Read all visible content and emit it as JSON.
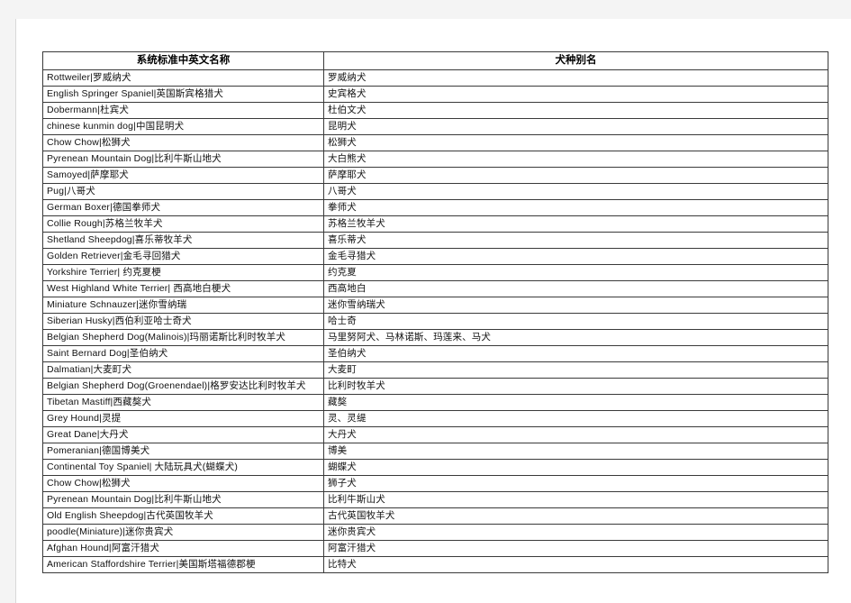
{
  "document": {
    "table": {
      "headers": [
        "系统标准中英文名称",
        "犬种别名"
      ],
      "rows": [
        {
          "name": "Rottweiler|罗威纳犬",
          "alias": "罗威纳犬"
        },
        {
          "name": "English Springer Spaniel|英国斯宾格猎犬",
          "alias": "史宾格犬"
        },
        {
          "name": "Dobermann|杜宾犬",
          "alias": "杜伯文犬"
        },
        {
          "name": "chinese kunmin dog|中国昆明犬",
          "alias": "昆明犬"
        },
        {
          "name": "Chow Chow|松狮犬",
          "alias": "松狮犬"
        },
        {
          "name": "Pyrenean Mountain Dog|比利牛斯山地犬",
          "alias": "大白熊犬"
        },
        {
          "name": "Samoyed|萨摩耶犬",
          "alias": "萨摩耶犬"
        },
        {
          "name": "Pug|八哥犬",
          "alias": "八哥犬"
        },
        {
          "name": "German Boxer|德国拳师犬",
          "alias": "拳师犬"
        },
        {
          "name": "Collie Rough|苏格兰牧羊犬",
          "alias": "苏格兰牧羊犬"
        },
        {
          "name": "Shetland Sheepdog|喜乐蒂牧羊犬",
          "alias": "喜乐蒂犬"
        },
        {
          "name": "Golden Retriever|金毛寻回猎犬",
          "alias": "金毛寻猎犬"
        },
        {
          "name": "Yorkshire Terrier| 约克夏梗",
          "alias": "约克夏"
        },
        {
          "name": "West Highland White Terrier| 西高地白梗犬",
          "alias": "西高地白"
        },
        {
          "name": "Miniature Schnauzer|迷你雪纳瑞",
          "alias": "迷你雪纳瑞犬"
        },
        {
          "name": "Siberian Husky|西伯利亚哈士奇犬",
          "alias": "哈士奇"
        },
        {
          "name": "Belgian Shepherd Dog(Malinois)|玛丽诺斯比利时牧羊犬",
          "alias": "马里努阿犬、马林诺斯、玛莲来、马犬"
        },
        {
          "name": "Saint Bernard Dog|圣伯纳犬",
          "alias": "圣伯纳犬"
        },
        {
          "name": "Dalmatian|大麦町犬",
          "alias": "大麦町"
        },
        {
          "name": "Belgian Shepherd Dog(Groenendael)|格罗安达比利时牧羊犬",
          "alias": "比利时牧羊犬"
        },
        {
          "name": "Tibetan Mastiff|西藏獒犬",
          "alias": "藏獒"
        },
        {
          "name": "Grey Hound|灵提",
          "alias": "灵、灵缇"
        },
        {
          "name": "Great Dane|大丹犬",
          "alias": "大丹犬"
        },
        {
          "name": "Pomeranian|德国博美犬",
          "alias": "博美"
        },
        {
          "name": "Continental Toy Spaniel| 大陆玩具犬(蝴蝶犬)",
          "alias": "蝴蝶犬"
        },
        {
          "name": "Chow Chow|松狮犬",
          "alias": "狮子犬"
        },
        {
          "name": "Pyrenean Mountain Dog|比利牛斯山地犬",
          "alias": "比利牛斯山犬"
        },
        {
          "name": "Old English Sheepdog|古代英国牧羊犬",
          "alias": "古代英国牧羊犬"
        },
        {
          "name": "poodle(Miniature)|迷你贵宾犬",
          "alias": "迷你贵宾犬"
        },
        {
          "name": "Afghan Hound|阿富汗猎犬",
          "alias": "阿富汗猎犬"
        },
        {
          "name": "American Staffordshire Terrier|美国斯塔福德郡梗",
          "alias": "比特犬"
        }
      ]
    }
  }
}
